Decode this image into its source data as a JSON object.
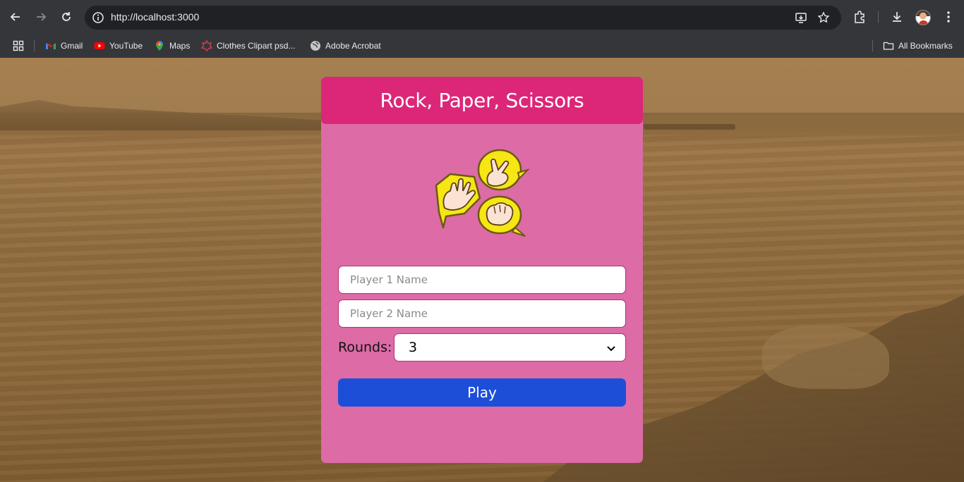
{
  "browser": {
    "url": "http://localhost:3000",
    "bookmarks": [
      {
        "label": "Gmail",
        "icon": "gmail-icon"
      },
      {
        "label": "YouTube",
        "icon": "youtube-icon"
      },
      {
        "label": "Maps",
        "icon": "maps-icon"
      },
      {
        "label": "Clothes Clipart psd...",
        "icon": "clipart-icon"
      },
      {
        "label": "Adobe Acrobat",
        "icon": "globe-icon"
      }
    ],
    "all_bookmarks_label": "All Bookmarks"
  },
  "game": {
    "title": "Rock, Paper, Scissors",
    "player1_placeholder": "Player 1 Name",
    "player2_placeholder": "Player 2 Name",
    "rounds_label": "Rounds:",
    "rounds_value": "3",
    "play_label": "Play"
  },
  "colors": {
    "header": "#dc2778",
    "card": "#dc6ba6",
    "play_button": "#1c4ed8",
    "input_border": "#b3306f"
  }
}
